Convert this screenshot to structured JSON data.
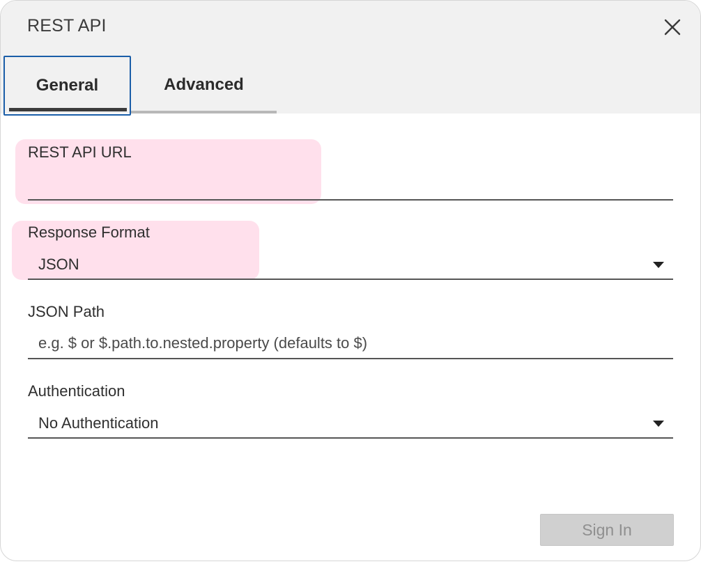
{
  "dialog": {
    "title": "REST API",
    "close_icon": "close-icon"
  },
  "tabs": [
    {
      "label": "General",
      "active": true
    },
    {
      "label": "Advanced",
      "active": false
    }
  ],
  "fields": {
    "url": {
      "label": "REST API URL",
      "value": ""
    },
    "response_format": {
      "label": "Response Format",
      "value": "JSON"
    },
    "json_path": {
      "label": "JSON Path",
      "placeholder": "e.g. $ or $.path.to.nested.property (defaults to $)",
      "value": ""
    },
    "authentication": {
      "label": "Authentication",
      "value": "No Authentication"
    }
  },
  "actions": {
    "sign_in_label": "Sign In",
    "sign_in_enabled": false
  },
  "colors": {
    "highlight": "#ffb6d2",
    "active_tab_border": "#1a5da8",
    "titlebar_bg": "#f1f1f1"
  }
}
